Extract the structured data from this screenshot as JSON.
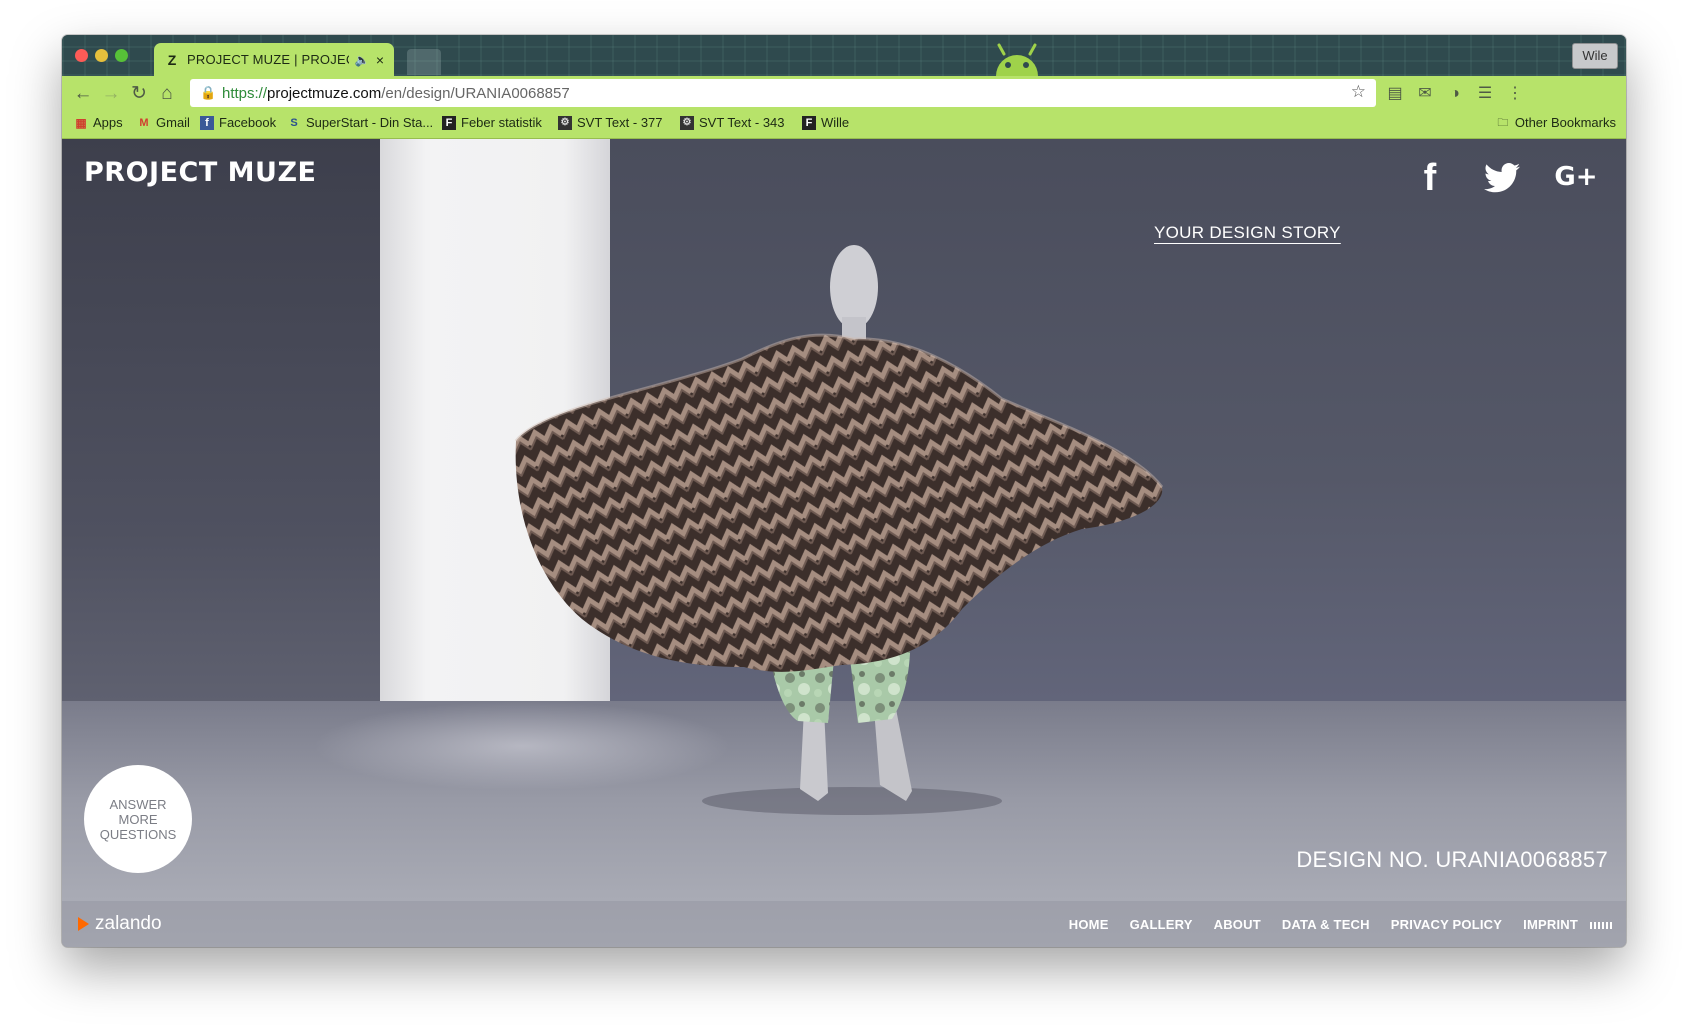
{
  "browser": {
    "tab": {
      "title": "PROJECT MUZE | PROJECT",
      "favicon": "Z",
      "audio_icon": "speaker-icon",
      "close": "×"
    },
    "profile_name": "Wile",
    "address": {
      "scheme": "https://",
      "host": "projectmuze.com",
      "path": "/en/design/URANIA0068857"
    },
    "bookmarks": [
      {
        "label": "Apps",
        "icon": "apps-grid-icon"
      },
      {
        "label": "Gmail",
        "icon": "gmail-icon"
      },
      {
        "label": "Facebook",
        "icon": "facebook-icon"
      },
      {
        "label": "SuperStart - Din Sta...",
        "icon": "superstart-icon"
      },
      {
        "label": "Feber statistik",
        "icon": "feber-icon"
      },
      {
        "label": "SVT Text - 377",
        "icon": "svt-icon"
      },
      {
        "label": "SVT Text - 343",
        "icon": "svt-icon"
      },
      {
        "label": "Wille",
        "icon": "feber-icon"
      }
    ],
    "other_bookmarks": "Other Bookmarks",
    "theme_color": "#b7e36a"
  },
  "site": {
    "logo": "PROJECT MUZE",
    "social": {
      "facebook": "f",
      "google_plus": "G+"
    },
    "story_link": "YOUR DESIGN STORY",
    "answer_button": "ANSWER MORE QUESTIONS",
    "design_number": "DESIGN NO. URANIA0068857",
    "footer_brand": "zalando",
    "footer_nav": [
      "HOME",
      "GALLERY",
      "ABOUT",
      "DATA & TECH",
      "PRIVACY POLICY",
      "IMPRINT"
    ]
  }
}
